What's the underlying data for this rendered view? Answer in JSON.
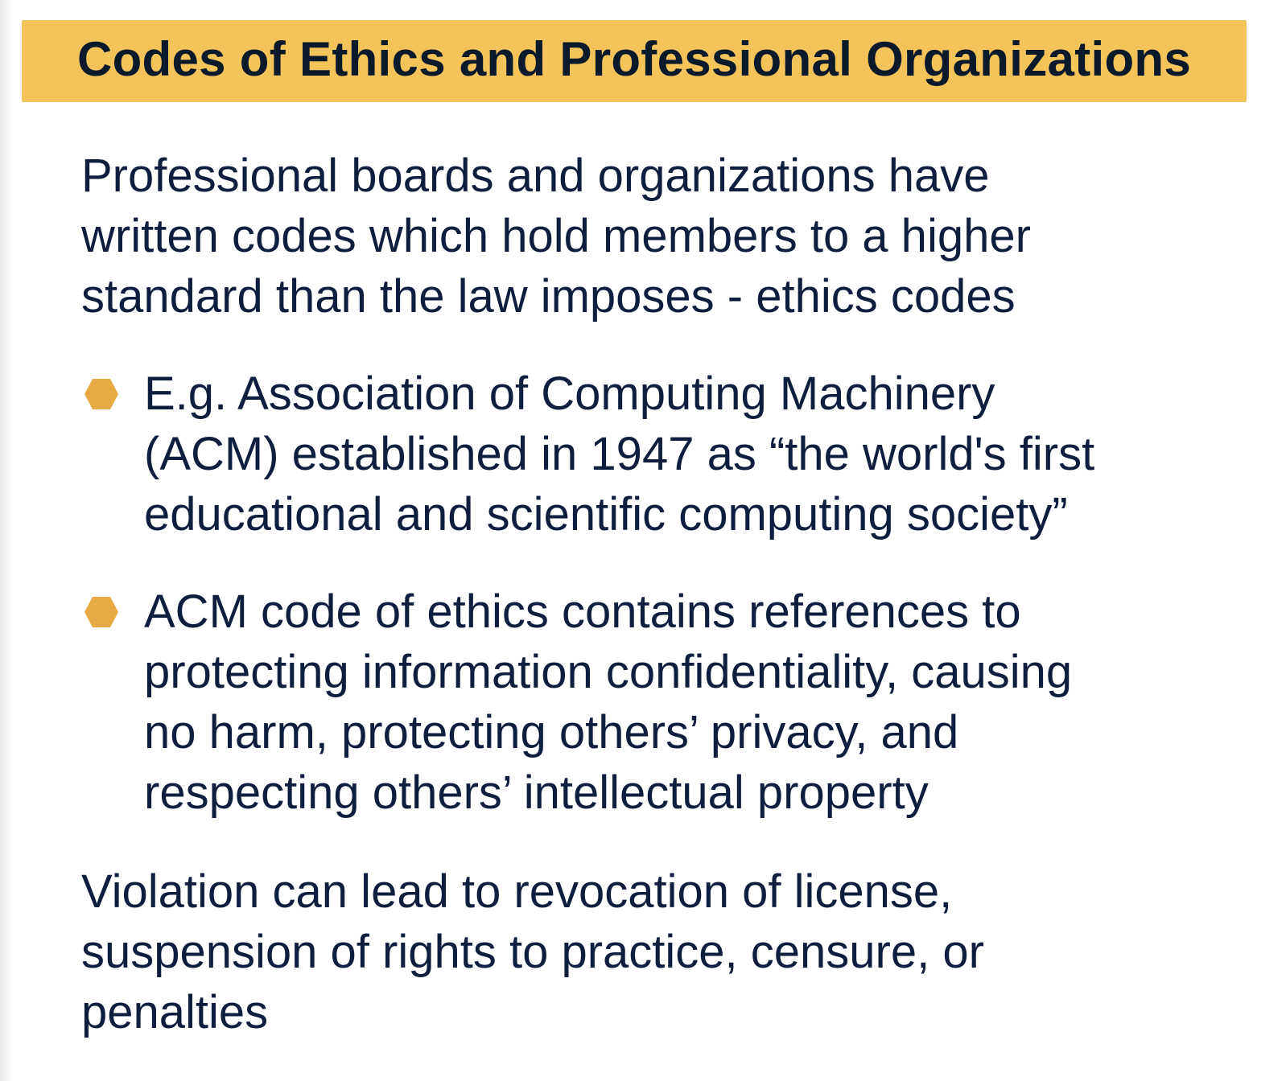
{
  "slide": {
    "title": "Codes of Ethics and Professional Organizations",
    "intro": {
      "lines": [
        "Professional boards and organizations have",
        "written codes which hold members to a higher",
        "standard than the law imposes - ethics codes"
      ]
    },
    "bullets": [
      {
        "icon": "hexagon-bullet-icon",
        "lines": [
          "E.g. Association of Computing Machinery",
          "(ACM) established in 1947 as “the world's first",
          "educational and scientific computing society”"
        ]
      },
      {
        "icon": "hexagon-bullet-icon",
        "lines": [
          "ACM code of ethics contains references to",
          "protecting information confidentiality, causing",
          "no harm, protecting others’ privacy, and",
          "respecting others’ intellectual property"
        ]
      }
    ],
    "closing": {
      "lines": [
        "Violation can lead to revocation of license,",
        "suspension of rights to practice, censure, or",
        "penalties"
      ]
    }
  },
  "colors": {
    "title_bar": "#f4c35a",
    "bullet": "#e8aa45",
    "text": "#0f1d3f"
  }
}
